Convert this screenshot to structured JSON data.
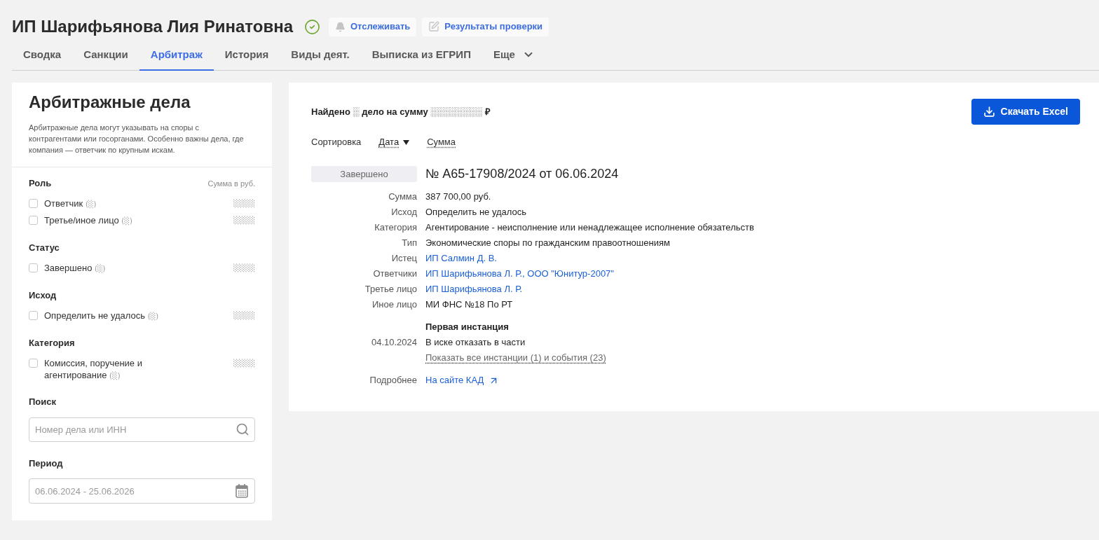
{
  "header": {
    "title": "ИП Шарифьянова Лия Ринатовна",
    "actions": [
      {
        "kind": "track",
        "label": "Отслеживать"
      },
      {
        "kind": "report",
        "label": "Результаты проверки"
      }
    ]
  },
  "tabs": [
    {
      "kind": "tab",
      "label": "Сводка",
      "selected": false
    },
    {
      "kind": "tab",
      "label": "Санкции",
      "selected": false
    },
    {
      "kind": "tab",
      "label": "Арбитраж",
      "selected": true
    },
    {
      "kind": "tab",
      "label": "История",
      "selected": false
    },
    {
      "kind": "tab",
      "label": "Виды деят.",
      "selected": false
    },
    {
      "kind": "tab",
      "label": "Выписка из ЕГРИП",
      "selected": false
    },
    {
      "kind": "more",
      "label": "Еще",
      "selected": false
    }
  ],
  "sidebar": {
    "title": "Арбитражные дела",
    "description": "Арбитражные дела могут указывать на споры с контрагентами или госорганами. Особенно важны дела, где компания — ответчик по крупным искам.",
    "filter_groups": [
      {
        "heading": "Роль",
        "column_label": "Сумма в руб.",
        "options": [
          {
            "label": "Ответчик",
            "count": "(░)",
            "amount": "░░░░",
            "checked": false
          },
          {
            "label": "Третье/иное лицо",
            "count": "(░)",
            "amount": "░░░░",
            "checked": false
          }
        ]
      },
      {
        "heading": "Статус",
        "options": [
          {
            "label": "Завершено",
            "count": "(░)",
            "amount": "░░░░",
            "checked": false
          }
        ]
      },
      {
        "heading": "Исход",
        "options": [
          {
            "label": "Определить не удалось",
            "count": "(░)",
            "amount": "░░░░",
            "checked": false
          }
        ]
      },
      {
        "heading": "Категория",
        "options": [
          {
            "label": "Комиссия, поручение и агентирование",
            "count": "(░)",
            "amount": "░░░░",
            "checked": false
          }
        ]
      }
    ],
    "search": {
      "heading": "Поиск",
      "placeholder": "Номер дела или ИНН"
    },
    "period": {
      "heading": "Период",
      "placeholder": "06.06.2024 - 25.06.2026"
    }
  },
  "results": {
    "summary": "Найдено ░ дело на сумму ░░░░░░░░ ₽",
    "download_button": "Скачать Excel",
    "sort": {
      "label": "Сортировка",
      "options": [
        {
          "label": "Дата",
          "selected": true
        },
        {
          "label": "Сумма",
          "selected": false
        }
      ]
    },
    "cases": [
      {
        "status": "Завершено",
        "title": "№ А65-17908/2024 от 06.06.2024",
        "fields": [
          {
            "kind": "text",
            "label": "Сумма",
            "value": "387 700,00 руб."
          },
          {
            "kind": "text",
            "label": "Исход",
            "value": "Определить не удалось"
          },
          {
            "kind": "text",
            "label": "Категория",
            "value": "Агентирование - неисполнение или ненадлежащее исполнение обязательств"
          },
          {
            "kind": "text",
            "label": "Тип",
            "value": "Экономические споры по гражданским правоотношениям"
          },
          {
            "kind": "links",
            "label": "Истец",
            "links": [
              "ИП Салмин Д. В."
            ]
          },
          {
            "kind": "links",
            "label": "Ответчики",
            "links": [
              "ИП Шарифьянова Л. Р.",
              "ООО \"Юнитур-2007\""
            ],
            "separator": ", "
          },
          {
            "kind": "links",
            "label": "Третье лицо",
            "links": [
              "ИП Шарифьянова Л. Р."
            ]
          },
          {
            "kind": "text",
            "label": "Иное лицо",
            "value": "МИ ФНС №18 По РТ"
          }
        ],
        "instance": {
          "heading": "Первая инстанция",
          "date": "04.10.2024",
          "result": "В иске отказать в части",
          "more_link": "Показать все инстанции (1) и события (23)"
        },
        "details": {
          "label": "Подробнее",
          "link": "На сайте КАД"
        }
      }
    ]
  }
}
